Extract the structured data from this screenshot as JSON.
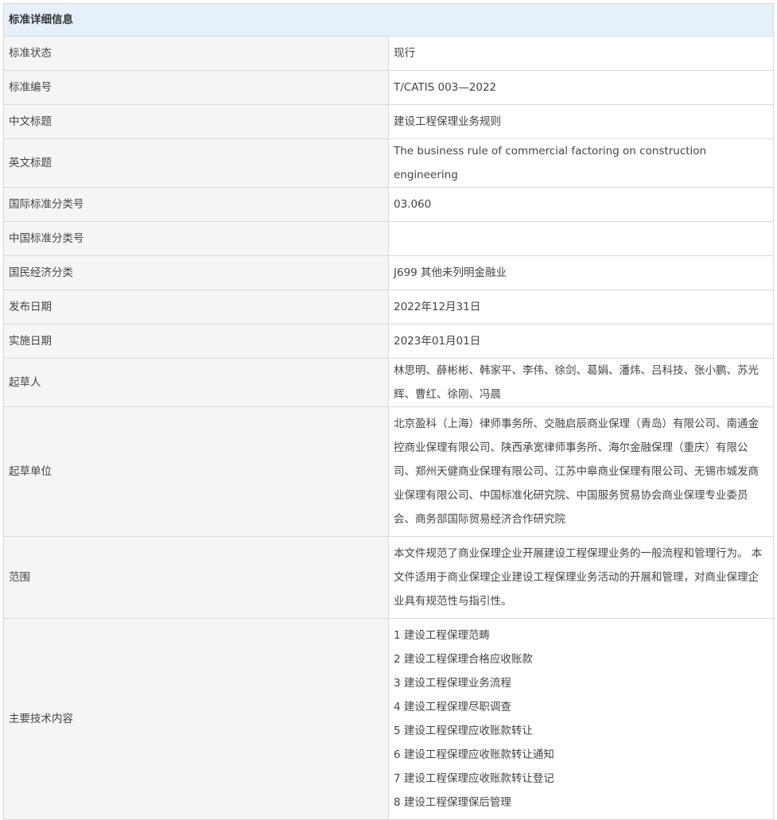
{
  "section_title": "标准详细信息",
  "rows": [
    {
      "label": "标准状态",
      "value": "现行"
    },
    {
      "label": "标准编号",
      "value": "T/CATIS 003—2022"
    },
    {
      "label": "中文标题",
      "value": "建设工程保理业务规则"
    },
    {
      "label": "英文标题",
      "value": "The business rule of commercial factoring on construction engineering"
    },
    {
      "label": "国际标准分类号",
      "value": "03.060"
    },
    {
      "label": "中国标准分类号",
      "value": ""
    },
    {
      "label": "国民经济分类",
      "value": "J699 其他未列明金融业"
    },
    {
      "label": "发布日期",
      "value": "2022年12月31日"
    },
    {
      "label": "实施日期",
      "value": "2023年01月01日"
    },
    {
      "label": "起草人",
      "value": "林思明、薛彬彬、韩家平、李伟、徐剑、葛娟、潘炜、吕科技、张小鹏、苏光辉、曹红、徐刚、冯晨"
    },
    {
      "label": "起草单位",
      "value": "北京盈科（上海）律师事务所、交融启辰商业保理（青岛）有限公司、南通金控商业保理有限公司、陕西承宽律师事务所、海尔金融保理（重庆）有限公司、郑州天健商业保理有限公司、江苏中皋商业保理有限公司、无锡市城发商业保理有限公司、中国标准化研究院、中国服务贸易协会商业保理专业委员会、商务部国际贸易经济合作研究院"
    },
    {
      "label": "范围",
      "value": "本文件规范了商业保理企业开展建设工程保理业务的一般流程和管理行为。 本文件适用于商业保理企业建设工程保理业务活动的开展和管理，对商业保理企业具有规范性与指引性。"
    }
  ],
  "main_content": {
    "label": "主要技术内容",
    "items": [
      "1 建设工程保理范畴",
      "2 建设工程保理合格应收账款",
      "3 建设工程保理业务流程",
      "4 建设工程保理尽职调查",
      "5 建设工程保理应收账款转让",
      "6 建设工程保理应收账款转让通知",
      "7 建设工程保理应收账款转让登记",
      "8 建设工程保理保后管理"
    ]
  }
}
